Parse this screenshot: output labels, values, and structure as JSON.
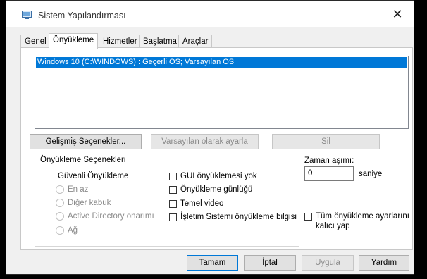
{
  "window": {
    "title": "Sistem Yapılandırması",
    "close_glyph": "✕"
  },
  "tabs": [
    {
      "label": "Genel"
    },
    {
      "label": "Önyükleme",
      "active": true
    },
    {
      "label": "Hizmetler"
    },
    {
      "label": "Başlatma"
    },
    {
      "label": "Araçlar"
    }
  ],
  "os_list": {
    "items": [
      "Windows 10 (C:\\WINDOWS) : Geçerli OS; Varsayılan OS"
    ]
  },
  "os_buttons": {
    "advanced": "Gelişmiş Seçenekler...",
    "set_default": "Varsayılan olarak ayarla",
    "delete": "Sil"
  },
  "boot_options": {
    "title": "Önyükleme Seçenekleri",
    "safe_boot": "Güvenli Önyükleme",
    "minimal": "En az",
    "alternate_shell": "Diğer kabuk",
    "active_directory": "Active Directory onarımı",
    "network": "Ağ",
    "no_gui": "GUI önyüklemesi yok",
    "boot_log": "Önyükleme günlüğü",
    "base_video": "Temel video",
    "os_boot_info": "İşletim Sistemi önyükleme bilgisi"
  },
  "timeout": {
    "label": "Zaman aşımı:",
    "value": "0",
    "unit": "saniye"
  },
  "permanent": {
    "line1": "Tüm önyükleme ayarlarını",
    "line2": "kalıcı yap"
  },
  "footer": {
    "ok": "Tamam",
    "cancel": "İptal",
    "apply": "Uygula",
    "help": "Yardım"
  },
  "colors": {
    "selection": "#0078d7",
    "focus_border": "#0078d7"
  },
  "icons": {
    "app": "system-config-icon",
    "close": "close-icon"
  }
}
